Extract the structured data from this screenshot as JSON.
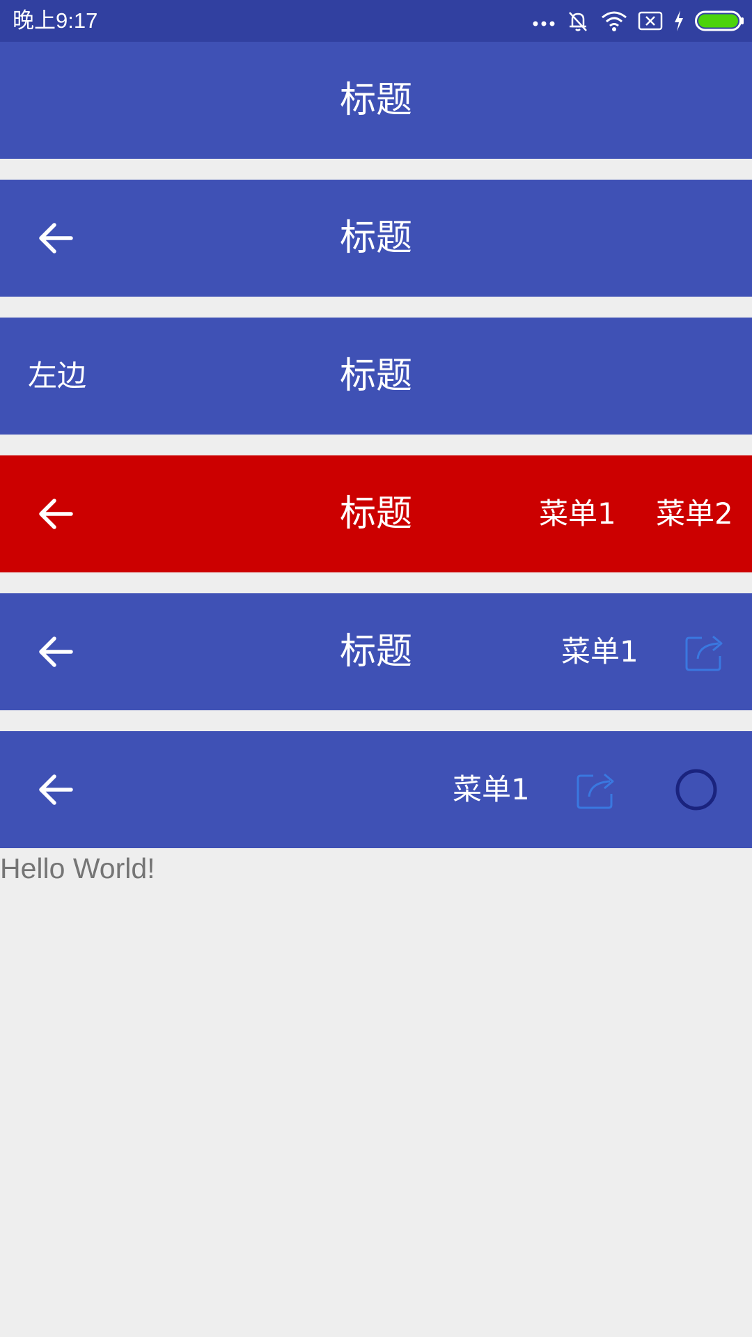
{
  "statusbar": {
    "time": "晚上9:17",
    "icons": [
      "more-dots-icon",
      "alarm-off-icon",
      "wifi-icon",
      "sim-x-icon",
      "charging-bolt-icon",
      "battery-icon"
    ],
    "battery_color": "#4cd30b"
  },
  "colors": {
    "primary": "#3f51b5",
    "accent_red": "#cc0000",
    "share_icon": "#3a78e0",
    "circle_icon": "#1a237e"
  },
  "toolbars": [
    {
      "title": "标题"
    },
    {
      "title": "标题",
      "left_icon": "back-arrow-icon"
    },
    {
      "title": "标题",
      "left_text": "左边"
    },
    {
      "title": "标题",
      "left_icon": "back-arrow-icon",
      "menus": [
        "菜单1",
        "菜单2"
      ]
    },
    {
      "title": "标题",
      "left_icon": "back-arrow-icon",
      "menus": [
        "菜单1"
      ],
      "right_icon": "share-icon"
    },
    {
      "left_icon": "back-arrow-icon",
      "menus": [
        "菜单1"
      ],
      "right_icons": [
        "share-icon",
        "circle-icon"
      ]
    }
  ],
  "content": {
    "text": "Hello World!"
  }
}
